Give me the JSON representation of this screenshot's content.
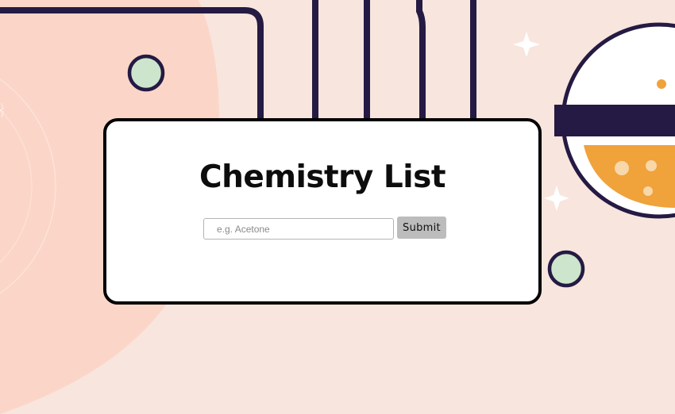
{
  "page": {
    "title": "Chemistry List"
  },
  "form": {
    "placeholder": "e.g. Acetone",
    "value": "",
    "submit_label": "Submit"
  },
  "colors": {
    "background": "#f8e5dd",
    "blob": "#fbd6c8",
    "tube_stroke": "#241a43",
    "bubble_fill": "#cde5cc",
    "liquid": "#f0a23b",
    "card_border": "#000000",
    "button": "#bcbcbc"
  }
}
